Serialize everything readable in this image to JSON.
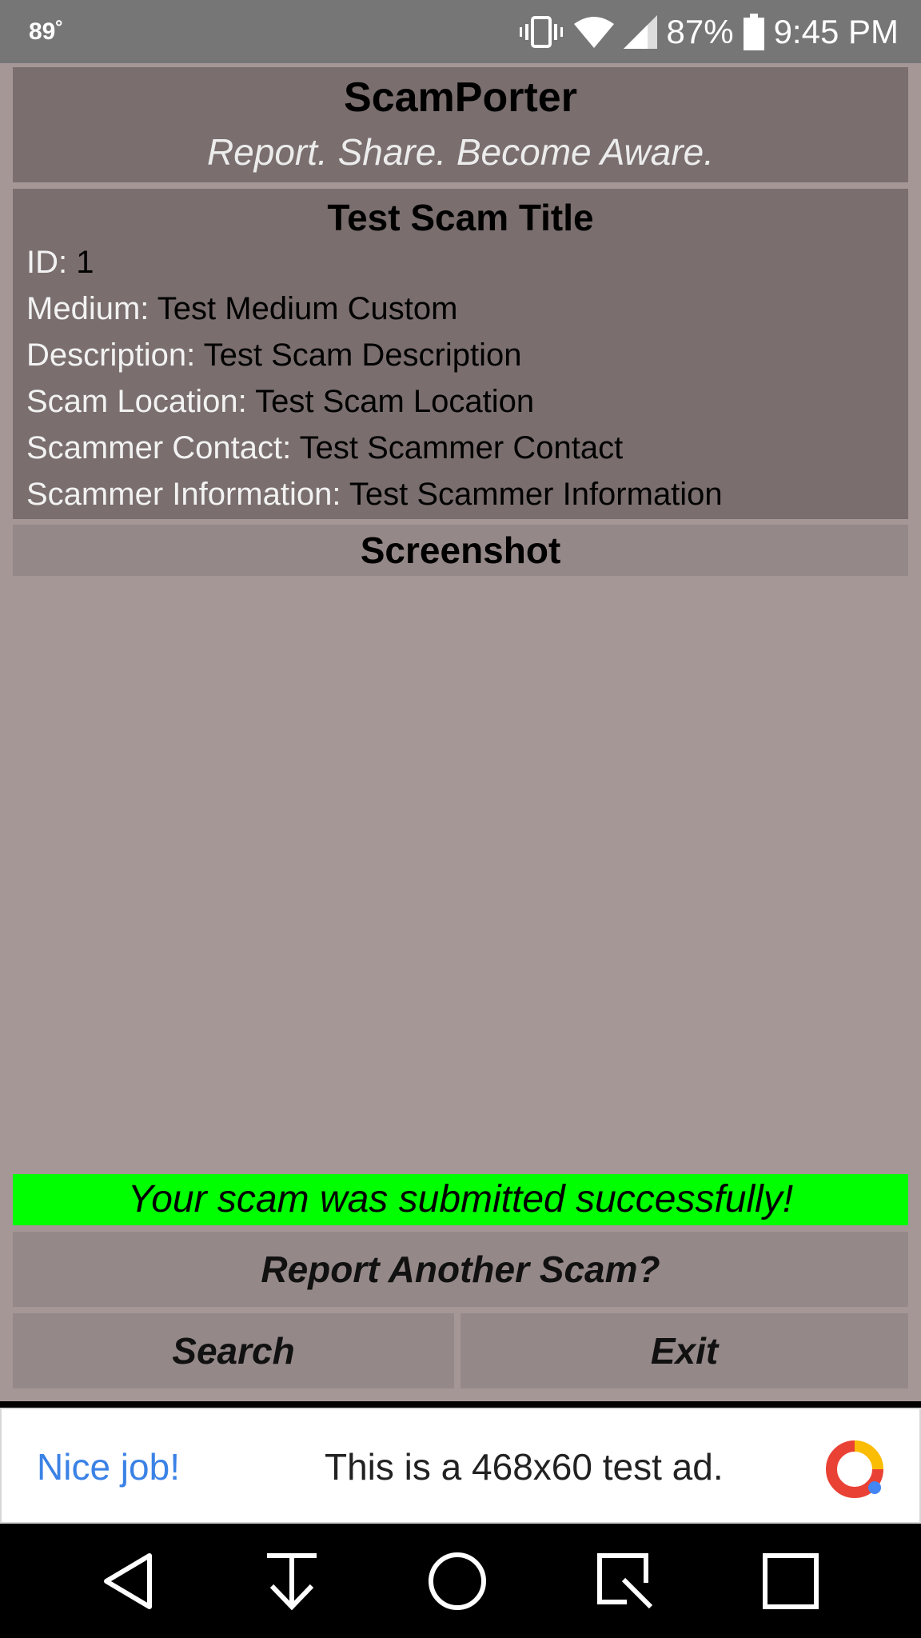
{
  "status_bar": {
    "temperature": "89˚",
    "battery": "87%",
    "time": "9:45 PM"
  },
  "header": {
    "title": "ScamPorter",
    "tagline": "Report. Share. Become Aware."
  },
  "scam": {
    "title": "Test Scam Title",
    "fields": [
      {
        "label": "ID:",
        "value": "1"
      },
      {
        "label": "Medium:",
        "value": "Test Medium Custom"
      },
      {
        "label": "Description:",
        "value": "Test Scam Description"
      },
      {
        "label": "Scam Location:",
        "value": "Test Scam Location"
      },
      {
        "label": "Scammer Contact:",
        "value": "Test Scammer Contact"
      },
      {
        "label": "Scammer Information:",
        "value": "Test Scammer Information"
      }
    ]
  },
  "screenshot_header": "Screenshot",
  "success_message": "Your scam was submitted successfully!",
  "buttons": {
    "report_another": "Report Another Scam?",
    "search": "Search",
    "exit": "Exit"
  },
  "ad": {
    "nice_job": "Nice job!",
    "text": "This is a 468x60 test ad."
  },
  "icons": {
    "status": [
      "vibrate-icon",
      "wifi-icon",
      "signal-icon",
      "battery-icon"
    ],
    "nav": [
      "back-icon",
      "download-icon",
      "home-icon",
      "screenshot-icon",
      "recents-icon"
    ]
  },
  "colors": {
    "background": "#a69797",
    "panel": "#7a6e6e",
    "button": "#958888",
    "success": "#00ff00",
    "ad_accent": "#3b82e6"
  }
}
